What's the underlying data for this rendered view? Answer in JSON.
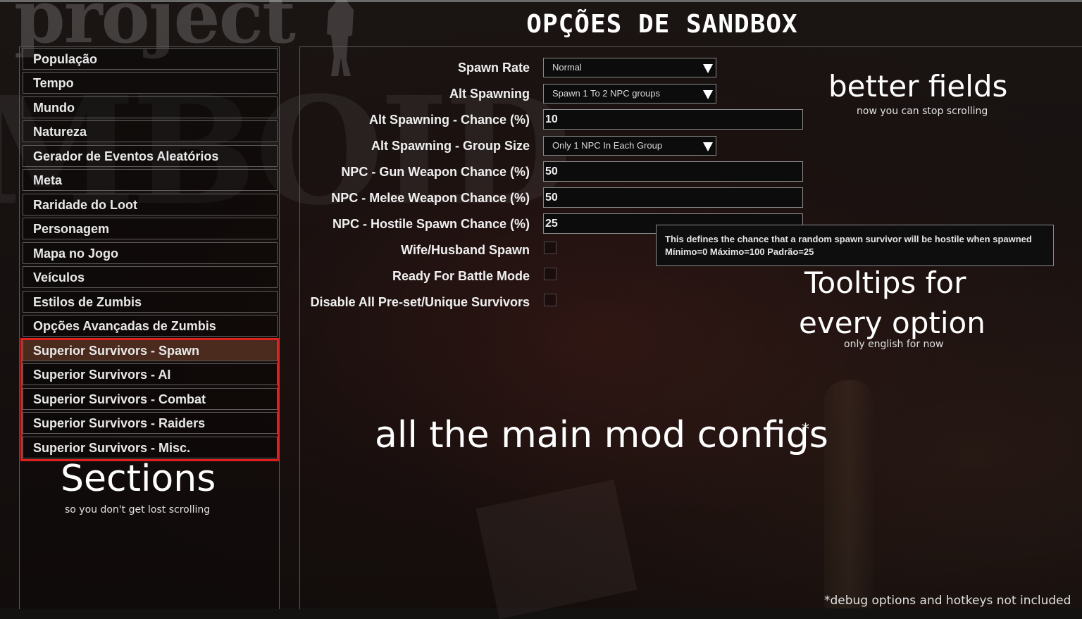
{
  "logo": {
    "top_text": "project",
    "bg_text": "MBOID"
  },
  "header": {
    "title": "OPÇÕES DE SANDBOX"
  },
  "sidebar": {
    "items": [
      {
        "label": "População"
      },
      {
        "label": "Tempo"
      },
      {
        "label": "Mundo"
      },
      {
        "label": "Natureza"
      },
      {
        "label": "Gerador de Eventos Aleatórios"
      },
      {
        "label": "Meta"
      },
      {
        "label": "Raridade do Loot"
      },
      {
        "label": "Personagem"
      },
      {
        "label": "Mapa no Jogo"
      },
      {
        "label": "Veículos"
      },
      {
        "label": "Estilos de Zumbis"
      },
      {
        "label": "Opções Avançadas de Zumbis"
      },
      {
        "label": "Superior Survivors - Spawn"
      },
      {
        "label": "Superior Survivors - AI"
      },
      {
        "label": "Superior Survivors - Combat"
      },
      {
        "label": "Superior Survivors - Raiders"
      },
      {
        "label": "Superior Survivors - Misc."
      }
    ],
    "selected_index": 12
  },
  "options": {
    "spawn_rate": {
      "label": "Spawn Rate",
      "value": "Normal"
    },
    "alt_spawning": {
      "label": "Alt Spawning",
      "value": "Spawn 1 To 2 NPC groups"
    },
    "alt_spawning_chance": {
      "label": "Alt Spawning - Chance (%)",
      "value": "10"
    },
    "alt_spawning_group_size": {
      "label": "Alt Spawning - Group Size",
      "value": "Only 1 NPC In Each Group"
    },
    "gun_weapon_chance": {
      "label": "NPC - Gun Weapon Chance (%)",
      "value": "50"
    },
    "melee_weapon_chance": {
      "label": "NPC - Melee Weapon Chance (%)",
      "value": "50"
    },
    "hostile_spawn_chance": {
      "label": "NPC - Hostile Spawn Chance (%)",
      "value": "25"
    },
    "wife_husband_spawn": {
      "label": "Wife/Husband Spawn",
      "checked": false
    },
    "ready_for_battle": {
      "label": "Ready For Battle Mode",
      "checked": false
    },
    "disable_preset": {
      "label": "Disable All Pre-set/Unique Survivors",
      "checked": false
    }
  },
  "tooltip": {
    "line1": "This defines the chance that a random spawn survivor will be hostile when spawned",
    "line2": "Mínimo=0 Máximo=100 Padrão=25"
  },
  "annotations": {
    "better_fields": "better fields",
    "better_fields_sub": "now you can stop scrolling",
    "tooltips_line1": "Tooltips for",
    "tooltips_line2": "every option",
    "tooltips_sub": "only english for now",
    "main_configs": "all the main mod configs",
    "asterisk": "*",
    "sections": "Sections",
    "sections_sub": "so you don't get lost scrolling",
    "footnote": "*debug options and hotkeys not included"
  },
  "colors": {
    "highlight_box": "#e0201c",
    "selected_item": "#784629"
  }
}
